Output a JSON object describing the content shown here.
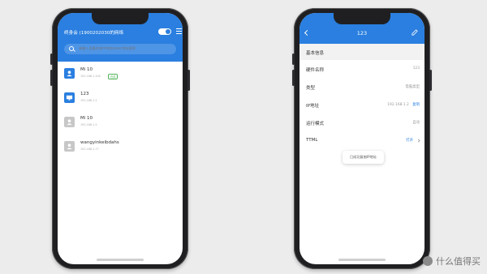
{
  "left_phone": {
    "header_title": "终身会 (1900202030的网络",
    "search_placeholder": "请输入设备名称/IP地址/MAC地址搜索",
    "devices": [
      {
        "name": "Mi 10",
        "ip": "192.168.1.100",
        "tag": "在线",
        "icon_color": "#2a7fe0",
        "icon": "phone-icon"
      },
      {
        "name": "123",
        "ip": "192.168.1.2",
        "tag": "",
        "icon_color": "#2a7fe0",
        "icon": "computer-icon"
      },
      {
        "name": "Mi 10",
        "ip": "192.168.1.5",
        "tag": "",
        "icon_color": "#c7c7c7",
        "icon": "phone-icon"
      },
      {
        "name": "wangyinkeibdahs",
        "ip": "192.168.1.77",
        "tag": "",
        "icon_color": "#c7c7c7",
        "icon": "phone-icon"
      }
    ]
  },
  "right_phone": {
    "header_title": "123",
    "section_title": "基本信息",
    "properties": [
      {
        "key": "硬件名称",
        "value": "123",
        "copy": ""
      },
      {
        "key": "类型",
        "value": "电脑类型",
        "copy": ""
      },
      {
        "key": "IP地址",
        "value": "192.168.1.2",
        "copy": "复制"
      },
      {
        "key": "运行模式",
        "value": "自动",
        "copy": ""
      },
      {
        "key": "TTML",
        "value": "打开",
        "copy": ""
      }
    ],
    "toast": "已成功复制IP地址"
  },
  "watermark": "什么值得买",
  "colors": {
    "brand_blue": "#2a7fe0",
    "background": "#ececec"
  }
}
